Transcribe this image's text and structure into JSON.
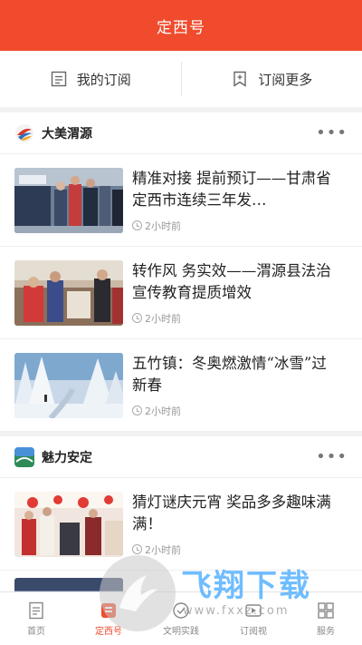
{
  "header": {
    "title": "定西号"
  },
  "subbar": {
    "my_subs": "我的订阅",
    "more_subs": "订阅更多"
  },
  "sections": [
    {
      "name": "大美渭源",
      "more": "•••",
      "items": [
        {
          "headline": "精准对接 提前预订——甘肃省定西市连续三年发…",
          "time": "2小时前"
        },
        {
          "headline": "转作风 务实效——渭源县法治宣传教育提质增效",
          "time": "2小时前"
        },
        {
          "headline": "五竹镇：冬奥燃激情“冰雪”过新春",
          "time": "2小时前"
        }
      ]
    },
    {
      "name": "魅力安定",
      "more": "•••",
      "items": [
        {
          "headline": "猜灯谜庆元宵 奖品多多趣味满满！",
          "time": "2小时前"
        }
      ]
    }
  ],
  "tabs": [
    {
      "label": "首页",
      "icon": "home-doc-icon",
      "active": false
    },
    {
      "label": "定西号",
      "icon": "dingxihao-icon",
      "active": true
    },
    {
      "label": "文明实践",
      "icon": "civilization-icon",
      "active": false
    },
    {
      "label": "订阅视",
      "icon": "video-icon",
      "active": false
    },
    {
      "label": "服务",
      "icon": "service-icon",
      "active": false
    }
  ],
  "watermark": {
    "brand": "飞翔下载",
    "url": "www.fxxz.com"
  },
  "colors": {
    "accent": "#ef4b2c"
  }
}
